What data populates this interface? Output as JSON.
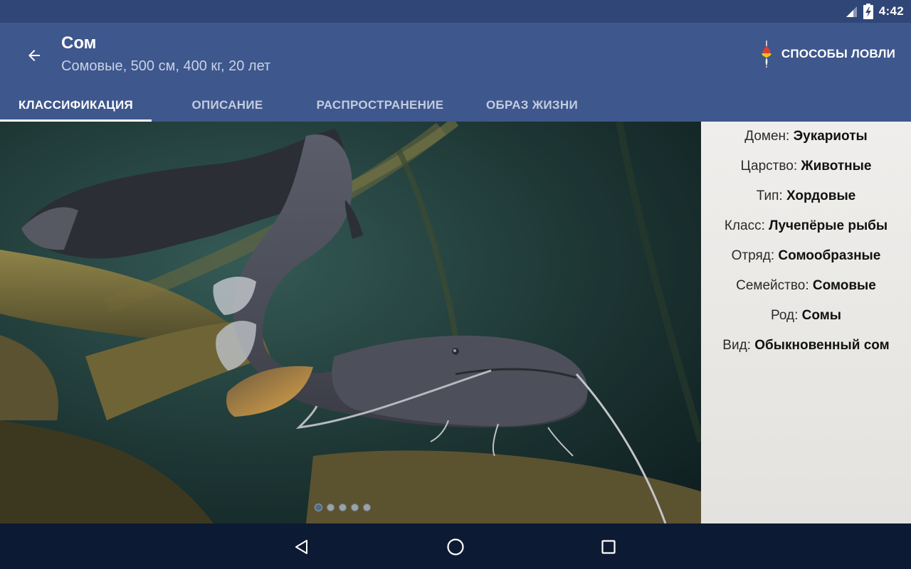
{
  "status_bar": {
    "time": "4:42",
    "icons": [
      "signal-icon",
      "battery-charging-icon"
    ]
  },
  "app_bar": {
    "title": "Сом",
    "subtitle": "Сомовые, 500 см, 400 кг, 20 лет",
    "action_label": "СПОСОБЫ ЛОВЛИ",
    "action_icon": "fishing-float-icon"
  },
  "tabs": [
    {
      "label": "КЛАССИФИКАЦИЯ",
      "active": true
    },
    {
      "label": "ОПИСАНИЕ",
      "active": false
    },
    {
      "label": "РАСПРОСТРАНЕНИЕ",
      "active": false
    },
    {
      "label": "ОБРАЗ ЖИЗНИ",
      "active": false
    }
  ],
  "gallery": {
    "page_count": 5,
    "active_index": 0
  },
  "classification": [
    {
      "label": "Домен:",
      "value": "Эукариоты"
    },
    {
      "label": "Царство:",
      "value": "Животные"
    },
    {
      "label": "Тип:",
      "value": "Хордовые"
    },
    {
      "label": "Класс:",
      "value": "Лучепёрые рыбы"
    },
    {
      "label": "Отряд:",
      "value": "Сомообразные"
    },
    {
      "label": "Семейство:",
      "value": "Сомовые"
    },
    {
      "label": "Род:",
      "value": "Сомы"
    },
    {
      "label": "Вид:",
      "value": "Обыкновенный сом"
    }
  ],
  "nav_bar": {
    "icons": [
      "back-triangle-icon",
      "home-circle-icon",
      "recents-square-icon"
    ]
  },
  "colors": {
    "status_bar": "#2f4677",
    "app_bar": "#3e578c",
    "nav_bar": "#0d1a33",
    "panel": "#ecebe8"
  }
}
